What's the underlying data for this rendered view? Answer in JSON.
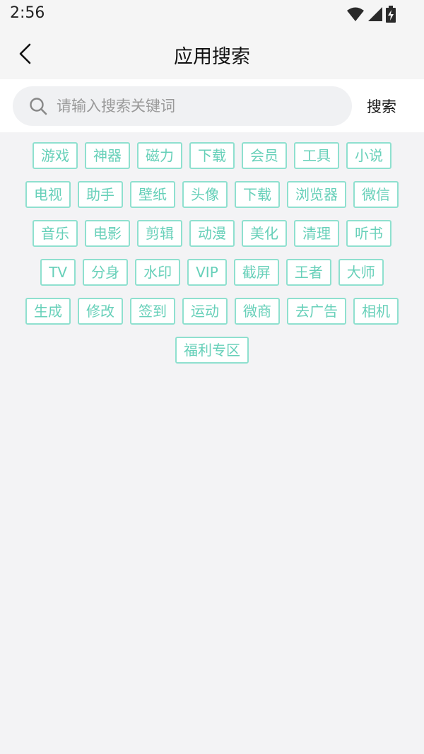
{
  "status_bar": {
    "time": "2:56",
    "icons": [
      "wifi-icon",
      "cell-signal-icon",
      "battery-charging-icon"
    ]
  },
  "app_bar": {
    "title": "应用搜索",
    "back_icon": "chevron-left-icon"
  },
  "search": {
    "placeholder": "请输入搜索关键词",
    "value": "",
    "icon": "search-icon",
    "button_label": "搜索"
  },
  "tags": {
    "rows": [
      [
        "游戏",
        "神器",
        "磁力",
        "下载",
        "会员",
        "工具",
        "小说"
      ],
      [
        "电视",
        "助手",
        "壁纸",
        "头像",
        "下载",
        "浏览器",
        "微信"
      ],
      [
        "音乐",
        "电影",
        "剪辑",
        "动漫",
        "美化",
        "清理",
        "听书"
      ],
      [
        "TV",
        "分身",
        "水印",
        "VIP",
        "截屏",
        "王者",
        "大师"
      ],
      [
        "生成",
        "修改",
        "签到",
        "运动",
        "微商",
        "去广告",
        "相机"
      ],
      [
        "福利专区"
      ]
    ]
  },
  "colors": {
    "tag_border": "#8fe0cf",
    "tag_text": "#67d0b9",
    "background": "#f3f3f5"
  }
}
